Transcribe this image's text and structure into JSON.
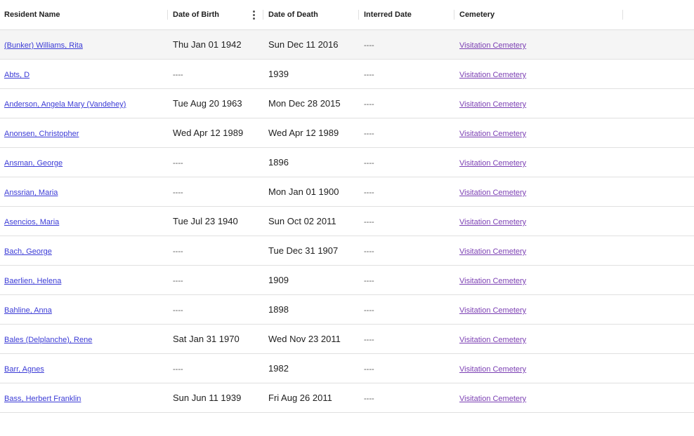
{
  "columns": {
    "resident_name": "Resident Name",
    "date_of_birth": "Date of Birth",
    "date_of_death": "Date of Death",
    "interred_date": "Interred Date",
    "cemetery": "Cemetery"
  },
  "rows": [
    {
      "name": "(Bunker) Williams, Rita",
      "birth": "Thu Jan 01 1942",
      "death": "Sun Dec 11 2016",
      "interred": "----",
      "cemetery": "Visitation Cemetery"
    },
    {
      "name": "Abts, D",
      "birth": "----",
      "death": "1939",
      "interred": "----",
      "cemetery": "Visitation Cemetery"
    },
    {
      "name": "Anderson, Angela Mary (Vandehey)",
      "birth": "Tue Aug 20 1963",
      "death": "Mon Dec 28 2015",
      "interred": "----",
      "cemetery": "Visitation Cemetery"
    },
    {
      "name": "Anonsen, Christopher",
      "birth": "Wed Apr 12 1989",
      "death": "Wed Apr 12 1989",
      "interred": "----",
      "cemetery": "Visitation Cemetery"
    },
    {
      "name": "Ansman, George",
      "birth": "----",
      "death": "1896",
      "interred": "----",
      "cemetery": "Visitation Cemetery"
    },
    {
      "name": "Anssrian, Maria",
      "birth": "----",
      "death": "Mon Jan 01 1900",
      "interred": "----",
      "cemetery": "Visitation Cemetery"
    },
    {
      "name": "Asencios, Maria",
      "birth": "Tue Jul 23 1940",
      "death": "Sun Oct 02 2011",
      "interred": "----",
      "cemetery": "Visitation Cemetery"
    },
    {
      "name": "Bach, George",
      "birth": "----",
      "death": "Tue Dec 31 1907",
      "interred": "----",
      "cemetery": "Visitation Cemetery"
    },
    {
      "name": "Baerlien, Helena",
      "birth": "----",
      "death": "1909",
      "interred": "----",
      "cemetery": "Visitation Cemetery"
    },
    {
      "name": "Bahline, Anna",
      "birth": "----",
      "death": "1898",
      "interred": "----",
      "cemetery": "Visitation Cemetery"
    },
    {
      "name": "Bales (Delplanche), Rene",
      "birth": "Sat Jan 31 1970",
      "death": "Wed Nov 23 2011",
      "interred": "----",
      "cemetery": "Visitation Cemetery"
    },
    {
      "name": "Barr, Agnes",
      "birth": "----",
      "death": "1982",
      "interred": "----",
      "cemetery": "Visitation Cemetery"
    },
    {
      "name": "Bass, Herbert Franklin",
      "birth": "Sun Jun 11 1939",
      "death": "Fri Aug 26 2011",
      "interred": "----",
      "cemetery": "Visitation Cemetery"
    }
  ],
  "hovered_row": 0,
  "icons": {
    "column_menu": "more-vert-icon"
  },
  "colors": {
    "name_link": "#3b3bd6",
    "cemetery_link": "#7b3fb3",
    "hover_row": "#f5f5f5",
    "divider": "#e0e0e0"
  }
}
